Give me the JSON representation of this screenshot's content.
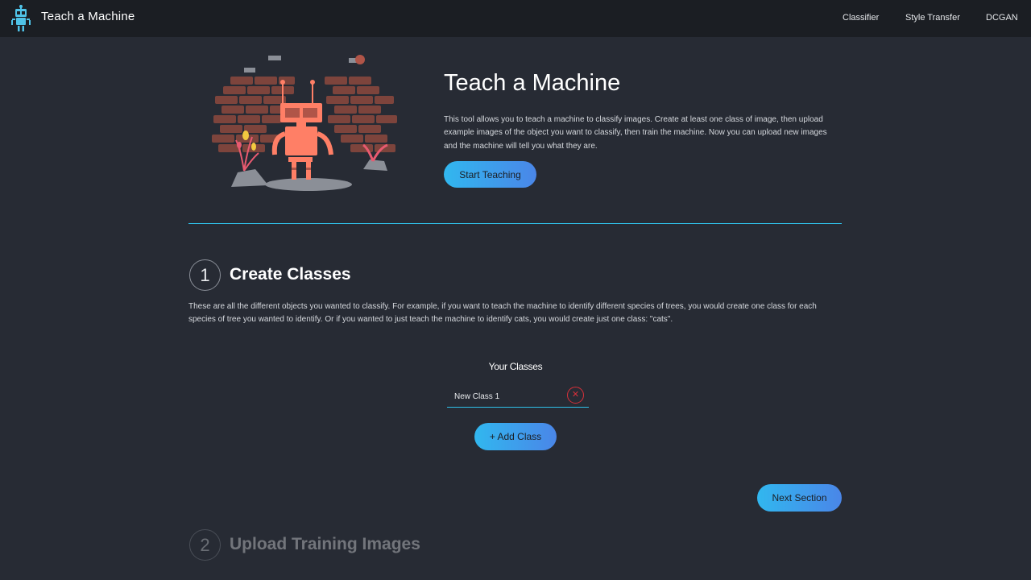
{
  "header": {
    "title": "Teach a Machine",
    "logo_icon": "robot-icon",
    "nav": [
      {
        "label": "Classifier"
      },
      {
        "label": "Style Transfer"
      },
      {
        "label": "DCGAN"
      }
    ]
  },
  "hero": {
    "title": "Teach a Machine",
    "description": "This tool allows you to teach a machine to classify images. Create at least one class of image, then upload example images of the object you want to classify, then train the machine. Now you can upload new images and the machine will tell you what they are.",
    "cta_label": "Start Teaching",
    "illustration_icon": "robot-brick-wall-illustration"
  },
  "sections": [
    {
      "number": "1",
      "title": "Create Classes",
      "description": "These are all the different objects you wanted to classify. For example, if you want to teach the machine to identify different species of trees, you would create one class for each species of tree you wanted to identify. Or if you wanted to just teach the machine to identify cats, you would create just one class: \"cats\".",
      "classes_label": "Your Classes",
      "classes": [
        {
          "value": "New Class 1",
          "remove_icon": "close-circle-icon"
        }
      ],
      "add_label": "+ Add Class",
      "next_label": "Next Section"
    },
    {
      "number": "2",
      "title": "Upload Training Images"
    }
  ],
  "colors": {
    "background": "#272b34",
    "navbar": "#1b1e23",
    "accent": "#2fc0e8",
    "button_gradient_start": "#31b7ef",
    "button_gradient_end": "#4a86e8",
    "danger": "#d8303a"
  }
}
